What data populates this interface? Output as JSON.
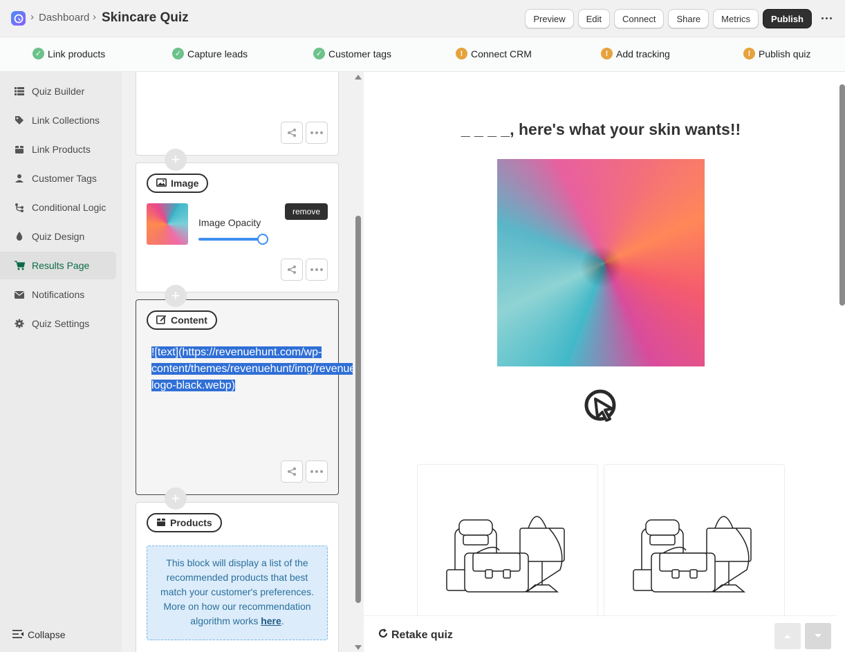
{
  "header": {
    "breadcrumb_parent": "Dashboard",
    "page_title": "Skincare Quiz",
    "separator": "›",
    "buttons": {
      "preview": "Preview",
      "edit": "Edit",
      "connect": "Connect",
      "share": "Share",
      "metrics": "Metrics",
      "publish": "Publish"
    }
  },
  "steps": [
    {
      "label": "Link products",
      "status": "done"
    },
    {
      "label": "Capture leads",
      "status": "done"
    },
    {
      "label": "Customer tags",
      "status": "done"
    },
    {
      "label": "Connect CRM",
      "status": "warning"
    },
    {
      "label": "Add tracking",
      "status": "warning"
    },
    {
      "label": "Publish quiz",
      "status": "warning"
    }
  ],
  "step_icons": {
    "done": "✓",
    "warning": "!"
  },
  "sidebar": {
    "items": [
      {
        "label": "Quiz Builder",
        "icon": "list-icon"
      },
      {
        "label": "Link Collections",
        "icon": "tag-icon"
      },
      {
        "label": "Link Products",
        "icon": "box-icon"
      },
      {
        "label": "Customer Tags",
        "icon": "user-icon"
      },
      {
        "label": "Conditional Logic",
        "icon": "branch-icon"
      },
      {
        "label": "Quiz Design",
        "icon": "drop-icon"
      },
      {
        "label": "Results Page",
        "icon": "cart-icon",
        "active": true
      },
      {
        "label": "Notifications",
        "icon": "envelope-icon"
      },
      {
        "label": "Quiz Settings",
        "icon": "gear-icon"
      }
    ],
    "collapse_label": "Collapse"
  },
  "editor": {
    "image_block": {
      "label": "Image",
      "opacity_label": "Image Opacity",
      "opacity_value": 0.92,
      "remove_label": "remove"
    },
    "content_block": {
      "label": "Content",
      "text": "![text](https://revenuehunt.com/wp-content/themes/revenuehunt/img/revenuehunt-logo-black.webp)"
    },
    "products_block": {
      "label": "Products",
      "info_text": "This block will display a list of the recommended products that best match your customer's preferences. More on how our recommendation algorithm works",
      "info_link": "here",
      "info_end": "."
    },
    "plus": "+"
  },
  "preview": {
    "headline": "_ _ _ _, here's what your skin wants!!",
    "retake_label": "Retake quiz"
  },
  "colors": {
    "accent_green": "#0b6b46",
    "done": "#6cc28a",
    "warning": "#e6a23c",
    "selection": "#2f6fd6",
    "info_bg": "#dcecfa"
  }
}
